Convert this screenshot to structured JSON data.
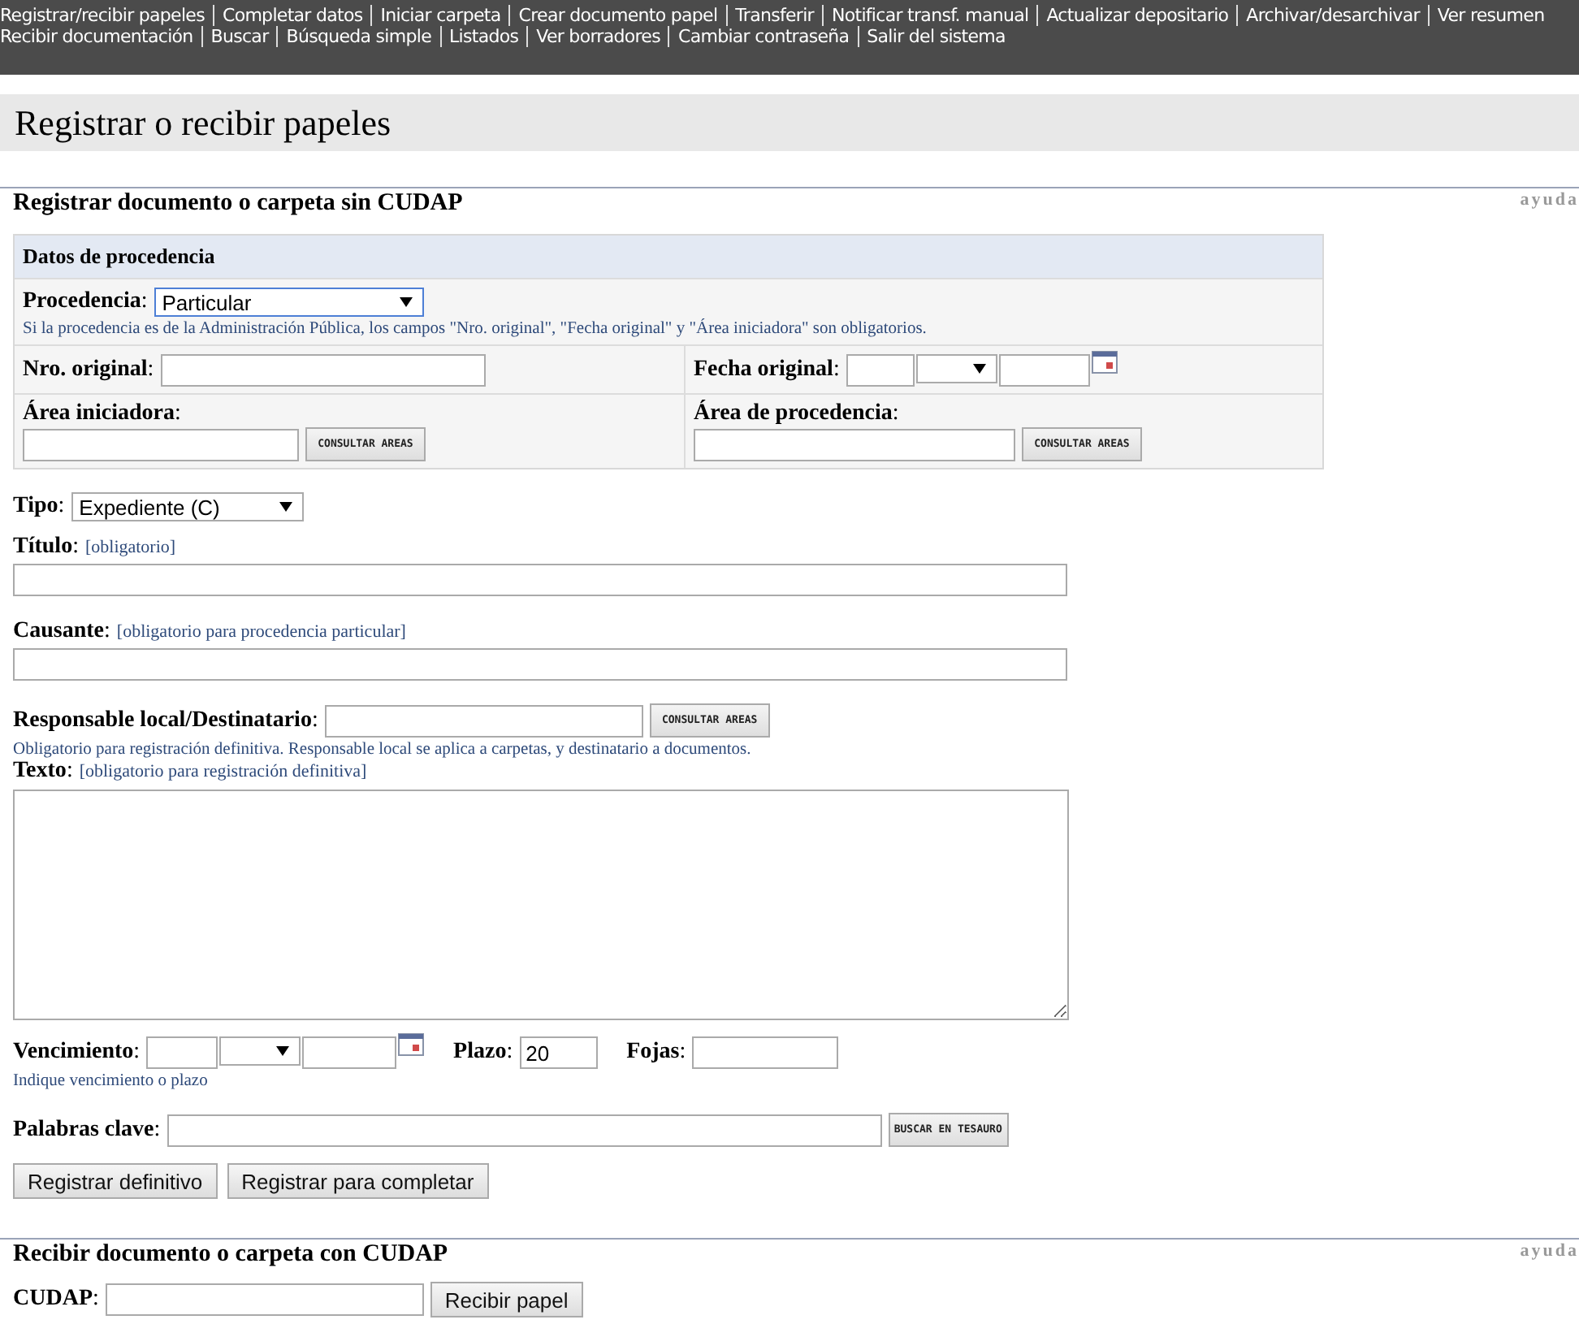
{
  "nav": {
    "first_line": [
      "Registrar/recibir papeles",
      "Completar datos",
      "Iniciar carpeta",
      "Crear documento papel",
      "Transferir",
      "Notificar transf. manual",
      "Actualizar depositario",
      "Archivar/desarchivar",
      "Ver resumen"
    ],
    "second_line": [
      "Recibir documentación",
      "Buscar",
      "Búsqueda simple",
      "Listados",
      "Ver borradores",
      "Cambiar contraseña",
      "Salir del sistema"
    ]
  },
  "page_title": "Registrar o recibir papeles",
  "register": {
    "title": "Registrar documento o carpeta sin CUDAP",
    "help": "ayuda",
    "origin_box": {
      "heading": "Datos de procedencia",
      "procedencia": {
        "label": "**Procedencia**:",
        "value": "Particular",
        "hint": "Si la procedencia es de la Administración Pública, los campos \"Nro. original\", \"Fecha original\" y \"Área iniciadora\" son obligatorios."
      },
      "nro_original": {
        "label": "**Nro. original**:"
      },
      "fecha_original": {
        "label": "**Fecha original**:"
      },
      "area_iniciadora": {
        "label": "**Área iniciadora**:",
        "button": "CONSULTAR AREAS"
      },
      "area_procedencia": {
        "label": "**Área de procedencia**:",
        "button": "CONSULTAR AREAS"
      }
    },
    "tipo": {
      "label": "**Tipo**:",
      "value": "Expediente (C)"
    },
    "titulo": {
      "label": "**Título**:",
      "hint": "[obligatorio]"
    },
    "causante": {
      "label": "**Causante**:",
      "hint": "[obligatorio para procedencia particular]"
    },
    "responsable": {
      "label": "**Responsable local/Destinatario**:",
      "button": "CONSULTAR AREAS",
      "hint": "Obligatorio para registración definitiva. Responsable local se aplica a carpetas, y destinatario a documentos."
    },
    "texto": {
      "label": "**Texto**:",
      "hint": "[obligatorio para registración definitiva]"
    },
    "vencimiento": {
      "label": "**Vencimiento**:",
      "hint": "Indique vencimiento o plazo"
    },
    "plazo": {
      "label": "**Plazo**:",
      "value": "20"
    },
    "fojas": {
      "label": "**Fojas**:"
    },
    "palabras": {
      "label": "**Palabras clave**:",
      "button": "BUSCAR EN TESAURO"
    },
    "buttons": [
      "Registrar definitivo",
      "Registrar para completar"
    ]
  },
  "receive": {
    "title": "Recibir documento o carpeta con CUDAP",
    "help": "ayuda",
    "cudap": {
      "label": "**CUDAP**:"
    },
    "button": "Recibir papel"
  }
}
